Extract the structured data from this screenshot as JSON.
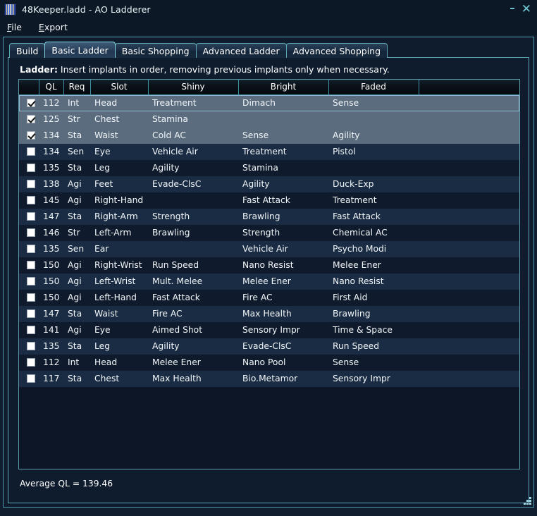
{
  "window": {
    "title": "48Keeper.ladd - AO Ladderer",
    "app_icon": "striped-book-icon",
    "minimize_label": "–",
    "close_label": "✕"
  },
  "menubar": {
    "items": [
      {
        "label": "File",
        "mnemonic": "F",
        "rest": "ile"
      },
      {
        "label": "Export",
        "mnemonic": "E",
        "rest": "xport"
      }
    ]
  },
  "tabs": [
    {
      "label": "Build",
      "active": false
    },
    {
      "label": "Basic Ladder",
      "active": true
    },
    {
      "label": "Basic Shopping",
      "active": false
    },
    {
      "label": "Advanced Ladder",
      "active": false
    },
    {
      "label": "Advanced Shopping",
      "active": false
    }
  ],
  "caption": {
    "title": "Ladder:",
    "description": "Insert implants in order, removing previous implants only when necessary."
  },
  "table": {
    "columns": [
      "",
      "QL",
      "Req",
      "Slot",
      "Shiny",
      "Bright",
      "Faded",
      ""
    ],
    "rows": [
      {
        "checked": true,
        "selected": true,
        "ql": "112",
        "req": "Int",
        "slot": "Head",
        "shiny": "Treatment",
        "bright": "Dimach",
        "faded": "Sense"
      },
      {
        "checked": true,
        "selected": true,
        "ql": "125",
        "req": "Str",
        "slot": "Chest",
        "shiny": "Stamina",
        "bright": "",
        "faded": ""
      },
      {
        "checked": true,
        "selected": true,
        "ql": "134",
        "req": "Sta",
        "slot": "Waist",
        "shiny": "Cold AC",
        "bright": "Sense",
        "faded": "Agility"
      },
      {
        "checked": false,
        "selected": false,
        "ql": "134",
        "req": "Sen",
        "slot": "Eye",
        "shiny": "Vehicle Air",
        "bright": "Treatment",
        "faded": "Pistol"
      },
      {
        "checked": false,
        "selected": false,
        "ql": "135",
        "req": "Sta",
        "slot": "Leg",
        "shiny": "Agility",
        "bright": "Stamina",
        "faded": ""
      },
      {
        "checked": false,
        "selected": false,
        "ql": "138",
        "req": "Agi",
        "slot": "Feet",
        "shiny": "Evade-ClsC",
        "bright": "Agility",
        "faded": "Duck-Exp"
      },
      {
        "checked": false,
        "selected": false,
        "ql": "145",
        "req": "Agi",
        "slot": "Right-Hand",
        "shiny": "",
        "bright": "Fast Attack",
        "faded": "Treatment"
      },
      {
        "checked": false,
        "selected": false,
        "ql": "147",
        "req": "Sta",
        "slot": "Right-Arm",
        "shiny": "Strength",
        "bright": "Brawling",
        "faded": "Fast Attack"
      },
      {
        "checked": false,
        "selected": false,
        "ql": "146",
        "req": "Str",
        "slot": "Left-Arm",
        "shiny": "Brawling",
        "bright": "Strength",
        "faded": "Chemical AC"
      },
      {
        "checked": false,
        "selected": false,
        "ql": "135",
        "req": "Sen",
        "slot": "Ear",
        "shiny": "",
        "bright": "Vehicle Air",
        "faded": "Psycho Modi"
      },
      {
        "checked": false,
        "selected": false,
        "ql": "150",
        "req": "Agi",
        "slot": "Right-Wrist",
        "shiny": "Run Speed",
        "bright": "Nano Resist",
        "faded": "Melee Ener"
      },
      {
        "checked": false,
        "selected": false,
        "ql": "150",
        "req": "Agi",
        "slot": "Left-Wrist",
        "shiny": "Mult. Melee",
        "bright": "Melee Ener",
        "faded": "Nano Resist"
      },
      {
        "checked": false,
        "selected": false,
        "ql": "150",
        "req": "Agi",
        "slot": "Left-Hand",
        "shiny": "Fast Attack",
        "bright": "Fire AC",
        "faded": "First Aid"
      },
      {
        "checked": false,
        "selected": false,
        "ql": "147",
        "req": "Sta",
        "slot": "Waist",
        "shiny": "Fire AC",
        "bright": "Max Health",
        "faded": "Brawling"
      },
      {
        "checked": false,
        "selected": false,
        "ql": "141",
        "req": "Agi",
        "slot": "Eye",
        "shiny": "Aimed Shot",
        "bright": "Sensory Impr",
        "faded": "Time & Space"
      },
      {
        "checked": false,
        "selected": false,
        "ql": "135",
        "req": "Sta",
        "slot": "Leg",
        "shiny": "Agility",
        "bright": "Evade-ClsC",
        "faded": "Run Speed"
      },
      {
        "checked": false,
        "selected": false,
        "ql": "112",
        "req": "Int",
        "slot": "Head",
        "shiny": "Melee Ener",
        "bright": "Nano Pool",
        "faded": "Sense"
      },
      {
        "checked": false,
        "selected": false,
        "ql": "117",
        "req": "Sta",
        "slot": "Chest",
        "shiny": "Max Health",
        "bright": "Bio.Metamor",
        "faded": "Sensory Impr"
      }
    ]
  },
  "status": {
    "average_ql": "Average QL = 139.46"
  },
  "colors": {
    "window_bg": "#111e30",
    "titlebar_bg": "#0c1825",
    "frame_border": "#5fa6b4",
    "panel_bg": "#0e1c2e",
    "grid_bg": "#0d1626",
    "row_even": "#0f1b2c",
    "row_odd": "#1a2c44",
    "row_selected": "#5a6c7e",
    "accent_cyan": "#6fc9d6",
    "text": "#f2f6f9"
  }
}
